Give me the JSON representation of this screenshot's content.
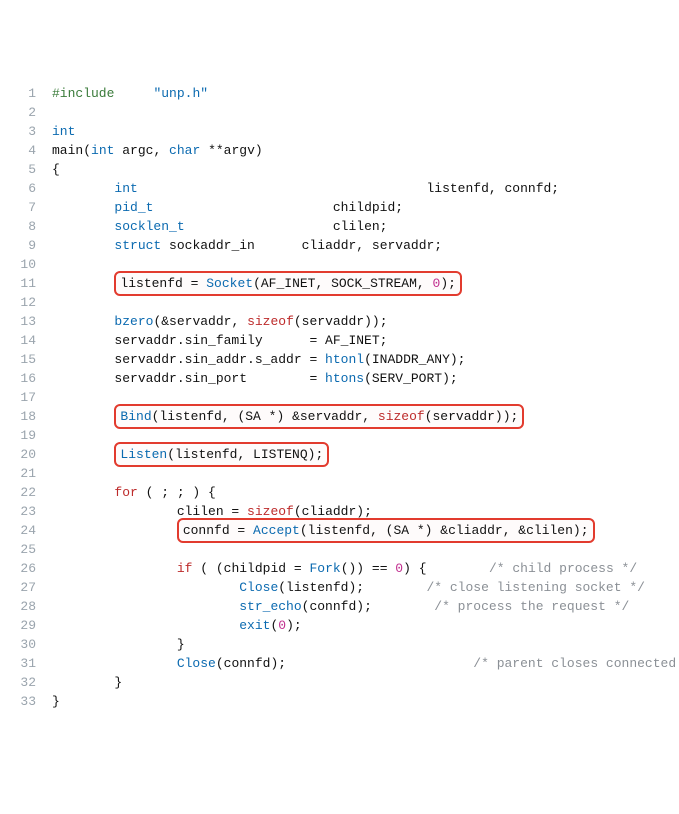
{
  "code": {
    "lines": [
      {
        "n": "1",
        "tokens": [
          {
            "t": "#include",
            "cls": "c-pp"
          },
          {
            "t": "     ",
            "cls": ""
          },
          {
            "t": "\"unp.h\"",
            "cls": "c-inc"
          }
        ]
      },
      {
        "n": "2",
        "tokens": []
      },
      {
        "n": "3",
        "tokens": [
          {
            "t": "int",
            "cls": "c-type"
          }
        ]
      },
      {
        "n": "4",
        "tokens": [
          {
            "t": "main",
            "cls": "c-id"
          },
          {
            "t": "(",
            "cls": ""
          },
          {
            "t": "int",
            "cls": "c-type"
          },
          {
            "t": " argc, ",
            "cls": "c-id"
          },
          {
            "t": "char",
            "cls": "c-type"
          },
          {
            "t": " **argv)",
            "cls": "c-id"
          }
        ]
      },
      {
        "n": "5",
        "tokens": [
          {
            "t": "{",
            "cls": ""
          }
        ]
      },
      {
        "n": "6",
        "tokens": [
          {
            "t": "        ",
            "cls": ""
          },
          {
            "t": "int",
            "cls": "c-type"
          },
          {
            "t": "                                     listenfd, connfd;",
            "cls": "c-id"
          }
        ]
      },
      {
        "n": "7",
        "tokens": [
          {
            "t": "        ",
            "cls": ""
          },
          {
            "t": "pid_t",
            "cls": "c-type"
          },
          {
            "t": "                       childpid;",
            "cls": "c-id"
          }
        ]
      },
      {
        "n": "8",
        "tokens": [
          {
            "t": "        ",
            "cls": ""
          },
          {
            "t": "socklen_t",
            "cls": "c-type"
          },
          {
            "t": "                   clilen;",
            "cls": "c-id"
          }
        ]
      },
      {
        "n": "9",
        "tokens": [
          {
            "t": "        ",
            "cls": ""
          },
          {
            "t": "struct",
            "cls": "c-kw"
          },
          {
            "t": " ",
            "cls": ""
          },
          {
            "t": "sockaddr_in",
            "cls": "c-id"
          },
          {
            "t": "      cliaddr, servaddr;",
            "cls": "c-id"
          }
        ]
      },
      {
        "n": "10",
        "tokens": []
      },
      {
        "n": "11",
        "indent": "        ",
        "hl": true,
        "tokens": [
          {
            "t": "listenfd = ",
            "cls": "c-id"
          },
          {
            "t": "Socket",
            "cls": "c-fn"
          },
          {
            "t": "(AF_INET, SOCK_STREAM, ",
            "cls": "c-id"
          },
          {
            "t": "0",
            "cls": "c-num"
          },
          {
            "t": ");",
            "cls": ""
          }
        ]
      },
      {
        "n": "12",
        "tokens": []
      },
      {
        "n": "13",
        "tokens": [
          {
            "t": "        ",
            "cls": ""
          },
          {
            "t": "bzero",
            "cls": "c-fn"
          },
          {
            "t": "(&servaddr, ",
            "cls": "c-id"
          },
          {
            "t": "sizeof",
            "cls": "c-szof"
          },
          {
            "t": "(servaddr));",
            "cls": "c-id"
          }
        ]
      },
      {
        "n": "14",
        "tokens": [
          {
            "t": "        servaddr.sin_family      = AF_INET;",
            "cls": "c-id"
          }
        ]
      },
      {
        "n": "15",
        "tokens": [
          {
            "t": "        servaddr.sin_addr.s_addr = ",
            "cls": "c-id"
          },
          {
            "t": "htonl",
            "cls": "c-fn"
          },
          {
            "t": "(INADDR_ANY);",
            "cls": "c-id"
          }
        ]
      },
      {
        "n": "16",
        "tokens": [
          {
            "t": "        servaddr.sin_port        = ",
            "cls": "c-id"
          },
          {
            "t": "htons",
            "cls": "c-fn"
          },
          {
            "t": "(SERV_PORT);",
            "cls": "c-id"
          }
        ]
      },
      {
        "n": "17",
        "tokens": []
      },
      {
        "n": "18",
        "indent": "        ",
        "hl": true,
        "tokens": [
          {
            "t": "Bind",
            "cls": "c-fn"
          },
          {
            "t": "(listenfd, (SA *) &servaddr, ",
            "cls": "c-id"
          },
          {
            "t": "sizeof",
            "cls": "c-szof"
          },
          {
            "t": "(servaddr));",
            "cls": "c-id"
          }
        ]
      },
      {
        "n": "19",
        "tokens": []
      },
      {
        "n": "20",
        "indent": "        ",
        "hl": true,
        "tokens": [
          {
            "t": "Listen",
            "cls": "c-fn"
          },
          {
            "t": "(listenfd, LISTENQ);",
            "cls": "c-id"
          }
        ]
      },
      {
        "n": "21",
        "tokens": []
      },
      {
        "n": "22",
        "tokens": [
          {
            "t": "        ",
            "cls": ""
          },
          {
            "t": "for",
            "cls": "c-ctrl"
          },
          {
            "t": " ( ; ; ) {",
            "cls": ""
          }
        ]
      },
      {
        "n": "23",
        "tokens": [
          {
            "t": "                clilen = ",
            "cls": "c-id"
          },
          {
            "t": "sizeof",
            "cls": "c-szof"
          },
          {
            "t": "(cliaddr);",
            "cls": "c-id"
          }
        ]
      },
      {
        "n": "24",
        "indent": "                ",
        "hl": true,
        "tokens": [
          {
            "t": "connfd = ",
            "cls": "c-id"
          },
          {
            "t": "Accept",
            "cls": "c-fn"
          },
          {
            "t": "(listenfd, (SA *) &cliaddr, &clilen);",
            "cls": "c-id"
          }
        ]
      },
      {
        "n": "25",
        "tokens": []
      },
      {
        "n": "26",
        "tokens": [
          {
            "t": "                ",
            "cls": ""
          },
          {
            "t": "if",
            "cls": "c-ctrl"
          },
          {
            "t": " ( (childpid = ",
            "cls": "c-id"
          },
          {
            "t": "Fork",
            "cls": "c-fn"
          },
          {
            "t": "()) == ",
            "cls": "c-id"
          },
          {
            "t": "0",
            "cls": "c-num"
          },
          {
            "t": ") {        ",
            "cls": ""
          },
          {
            "t": "/* child process */",
            "cls": "c-cmt"
          }
        ]
      },
      {
        "n": "27",
        "tokens": [
          {
            "t": "                        ",
            "cls": ""
          },
          {
            "t": "Close",
            "cls": "c-fn"
          },
          {
            "t": "(listenfd);        ",
            "cls": "c-id"
          },
          {
            "t": "/* close listening socket */",
            "cls": "c-cmt"
          }
        ]
      },
      {
        "n": "28",
        "tokens": [
          {
            "t": "                        ",
            "cls": ""
          },
          {
            "t": "str_echo",
            "cls": "c-fn"
          },
          {
            "t": "(connfd);        ",
            "cls": "c-id"
          },
          {
            "t": "/* process the request */",
            "cls": "c-cmt"
          }
        ]
      },
      {
        "n": "29",
        "tokens": [
          {
            "t": "                        ",
            "cls": ""
          },
          {
            "t": "exit",
            "cls": "c-fn"
          },
          {
            "t": "(",
            "cls": ""
          },
          {
            "t": "0",
            "cls": "c-num"
          },
          {
            "t": ");",
            "cls": ""
          }
        ]
      },
      {
        "n": "30",
        "tokens": [
          {
            "t": "                }",
            "cls": ""
          }
        ]
      },
      {
        "n": "31",
        "tokens": [
          {
            "t": "                ",
            "cls": ""
          },
          {
            "t": "Close",
            "cls": "c-fn"
          },
          {
            "t": "(connfd);                        ",
            "cls": "c-id"
          },
          {
            "t": "/* parent closes connected socket */",
            "cls": "c-cmt"
          }
        ]
      },
      {
        "n": "32",
        "tokens": [
          {
            "t": "        }",
            "cls": ""
          }
        ]
      },
      {
        "n": "33",
        "tokens": [
          {
            "t": "}",
            "cls": ""
          }
        ]
      }
    ]
  }
}
